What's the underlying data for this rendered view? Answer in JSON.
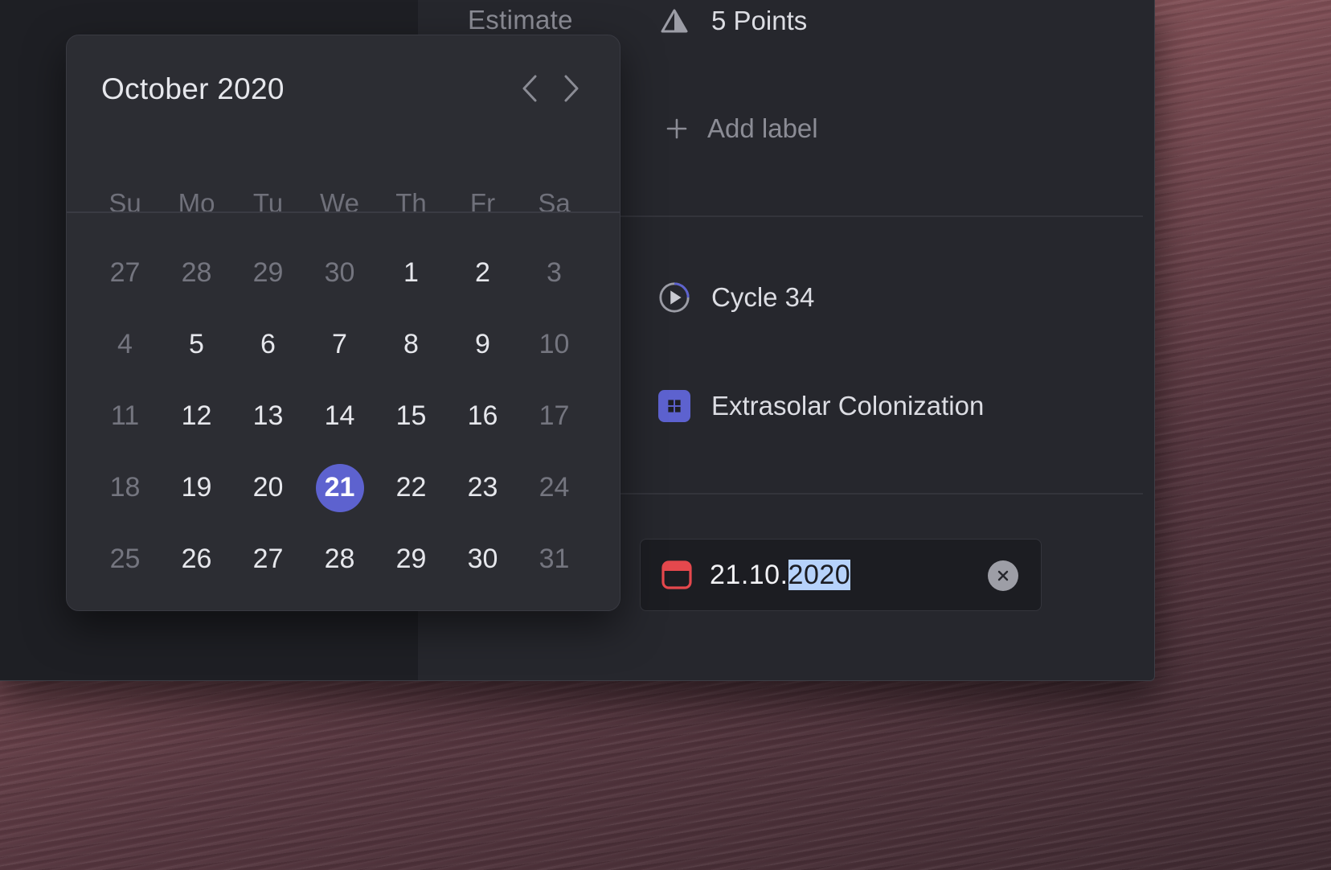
{
  "properties": {
    "estimate_label": "Estimate",
    "estimate_value": "5 Points",
    "add_label": "Add label",
    "cycle": "Cycle 34",
    "project": "Extrasolar Colonization",
    "due_date": {
      "prefix": "21.10.",
      "selected": "2020"
    }
  },
  "calendar": {
    "title": "October 2020",
    "weekdays": [
      "Su",
      "Mo",
      "Tu",
      "We",
      "Th",
      "Fr",
      "Sa"
    ],
    "days": [
      {
        "d": "27",
        "muted": true
      },
      {
        "d": "28",
        "muted": true
      },
      {
        "d": "29",
        "muted": true
      },
      {
        "d": "30",
        "muted": true
      },
      {
        "d": "1"
      },
      {
        "d": "2"
      },
      {
        "d": "3",
        "muted": true
      },
      {
        "d": "4",
        "muted": true
      },
      {
        "d": "5"
      },
      {
        "d": "6"
      },
      {
        "d": "7"
      },
      {
        "d": "8"
      },
      {
        "d": "9"
      },
      {
        "d": "10",
        "muted": true
      },
      {
        "d": "11",
        "muted": true
      },
      {
        "d": "12"
      },
      {
        "d": "13"
      },
      {
        "d": "14"
      },
      {
        "d": "15"
      },
      {
        "d": "16"
      },
      {
        "d": "17",
        "muted": true
      },
      {
        "d": "18",
        "muted": true
      },
      {
        "d": "19"
      },
      {
        "d": "20"
      },
      {
        "d": "21",
        "selected": true
      },
      {
        "d": "22"
      },
      {
        "d": "23"
      },
      {
        "d": "24",
        "muted": true
      },
      {
        "d": "25",
        "muted": true
      },
      {
        "d": "26"
      },
      {
        "d": "27"
      },
      {
        "d": "28"
      },
      {
        "d": "29"
      },
      {
        "d": "30"
      },
      {
        "d": "31",
        "muted": true
      }
    ]
  },
  "icons": {
    "estimate": "triangle-estimate-icon",
    "add": "plus-icon",
    "cycle": "cycle-play-icon",
    "project": "project-grid-icon",
    "date": "calendar-icon",
    "clear": "clear-x-icon",
    "prev": "chevron-left-icon",
    "next": "chevron-right-icon"
  },
  "colors": {
    "accent": "#5d62cf",
    "selection": "#b6d2fb",
    "calendar_icon": "#e5484d"
  }
}
